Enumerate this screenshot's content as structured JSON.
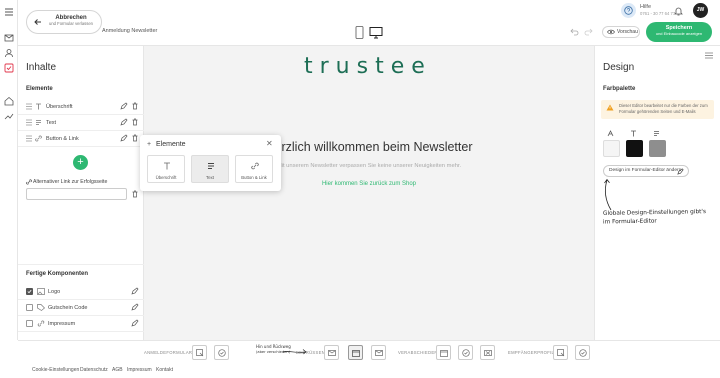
{
  "header": {
    "back_title": "Abbrechen",
    "back_subtitle": "und Formular verlassen",
    "document_title": "Anmeldung Newsletter",
    "help_title": "Hilfe",
    "help_phone": "0761 - 30 77 64 77",
    "avatar_initials": "JW",
    "preview_label": "Vorschau",
    "save_title": "Speichern",
    "save_subtitle": "und Einbaucode anzeigen"
  },
  "left_panel": {
    "title": "Inhalte",
    "elements_heading": "Elemente",
    "elements": [
      {
        "label": "Überschrift",
        "icon": "text-heading-icon"
      },
      {
        "label": "Text",
        "icon": "paragraph-icon"
      },
      {
        "label": "Button & Link",
        "icon": "link-icon"
      }
    ],
    "alt_link_label": "Alternativer Link zur Erfolgsseite",
    "alt_link_value": "",
    "components_heading": "Fertige Komponenten",
    "components": [
      {
        "label": "Logo",
        "checked": true,
        "icon": "image-icon"
      },
      {
        "label": "Gutschein Code",
        "checked": false,
        "icon": "tag-icon"
      },
      {
        "label": "Impressum",
        "checked": false,
        "icon": "link-icon"
      }
    ]
  },
  "canvas": {
    "logo_text": "trustee",
    "headline": "Herzlich willkommen beim Newsletter",
    "subtext": "Mit unserem Newsletter verpassen Sie keine unserer Neuigkeiten mehr.",
    "shop_link": "Hier kommen Sie zurück zum Shop"
  },
  "popup": {
    "title": "Elemente",
    "tiles": [
      {
        "label": "Überschrift",
        "icon": "text-heading-icon",
        "active": false
      },
      {
        "label": "Text",
        "icon": "paragraph-icon",
        "active": true
      },
      {
        "label": "Button & Link",
        "icon": "link-icon",
        "active": false
      }
    ]
  },
  "right_panel": {
    "title": "Design",
    "palette_heading": "Farbpalette",
    "notice": "Dieser Editor bearbeitet nur die Farben der zum Formular gehörenden Seiten und E-Mails",
    "swatch_colors": [
      "#f5f5f5",
      "#111111",
      "#8e8e8e"
    ],
    "editor_button": "Design im Formular-Editor ändern",
    "handwritten_note_line1": "Globale Design-Einstellungen gibt's",
    "handwritten_note_line2": "im Formular-Editor"
  },
  "workflow": {
    "stages": [
      {
        "label": "ANMELDEFORMULAR"
      },
      {
        "label": "BEGRÜSSEN"
      },
      {
        "label": "VERABSCHIEDEN"
      },
      {
        "label": "EMPFÄNGERPROFIL"
      }
    ],
    "hand_note_line1": "Hin und Rückweg",
    "hand_note_line2": "(aber verschieden)"
  },
  "footer": {
    "links": [
      "Cookie-Einstellungen",
      "Datenschutz",
      "AGB",
      "Impressum",
      "Kontakt"
    ]
  },
  "colors": {
    "accent_green": "#2eb872",
    "logo_green": "#1d6e55",
    "brand_red": "#e0344a"
  }
}
